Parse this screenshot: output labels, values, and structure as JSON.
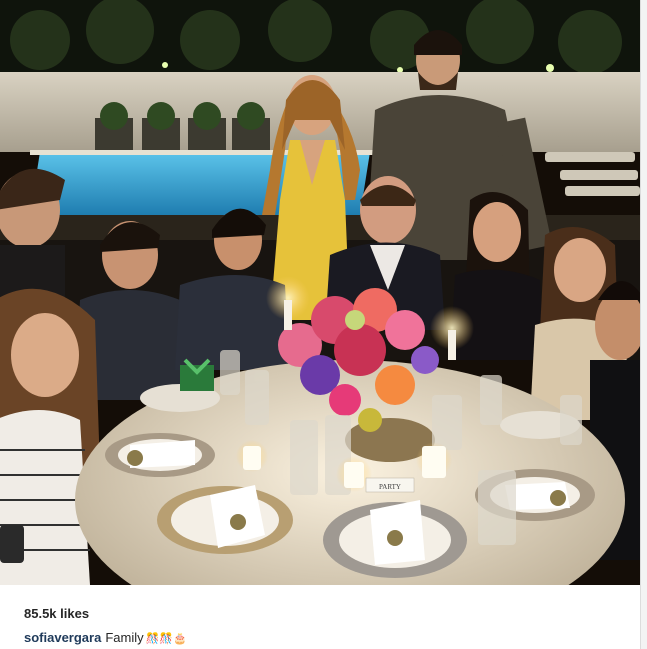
{
  "post": {
    "likes_text": "85.5k likes",
    "caption_user": "sofiavergara",
    "caption_text": "Family",
    "caption_emoji": "🎊🎊🎂"
  },
  "photo": {
    "place_card_text": "PARTY"
  },
  "colors": {
    "username": "#1f3a5a",
    "pool": "#35a9d6",
    "night_sky": "#140d07"
  }
}
